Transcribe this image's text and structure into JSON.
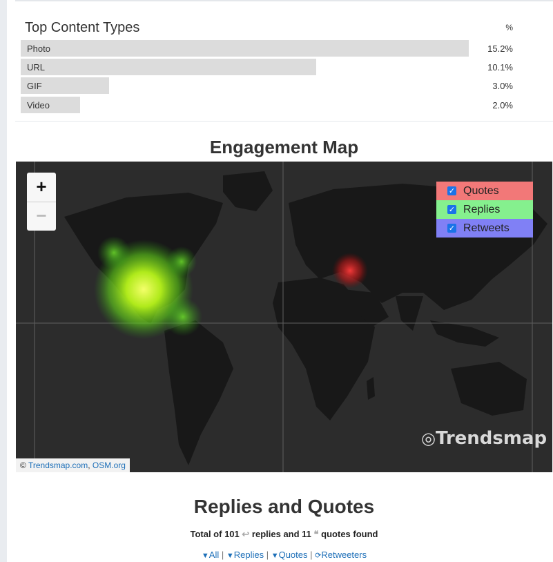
{
  "content_types": {
    "title": "Top Content Types",
    "pct_header": "%",
    "rows": [
      {
        "label": "Photo",
        "value": "15.2%",
        "fraction": 0.91
      },
      {
        "label": "URL",
        "value": "10.1%",
        "fraction": 0.6
      },
      {
        "label": "GIF",
        "value": "3.0%",
        "fraction": 0.18
      },
      {
        "label": "Video",
        "value": "2.0%",
        "fraction": 0.12
      }
    ]
  },
  "engagement_map": {
    "title": "Engagement Map",
    "zoom_in": "+",
    "zoom_out": "−",
    "legend": [
      {
        "label": "Quotes",
        "checked": true,
        "color": "#f27878"
      },
      {
        "label": "Replies",
        "checked": true,
        "color": "#85f08e"
      },
      {
        "label": "Retweets",
        "checked": true,
        "color": "#8080f5"
      }
    ],
    "attribution_prefix": "©",
    "attribution_link1": "Trendsmap.com",
    "attribution_sep": ",",
    "attribution_link2": "OSM.org",
    "brand_logo": "Trendsmap"
  },
  "replies_quotes": {
    "title": "Replies and Quotes",
    "summary_prefix": "Total of 101",
    "summary_mid": "replies and 11",
    "summary_suffix": "quotes found",
    "filters": [
      "All",
      "Replies",
      "Quotes",
      "Retweeters"
    ]
  }
}
